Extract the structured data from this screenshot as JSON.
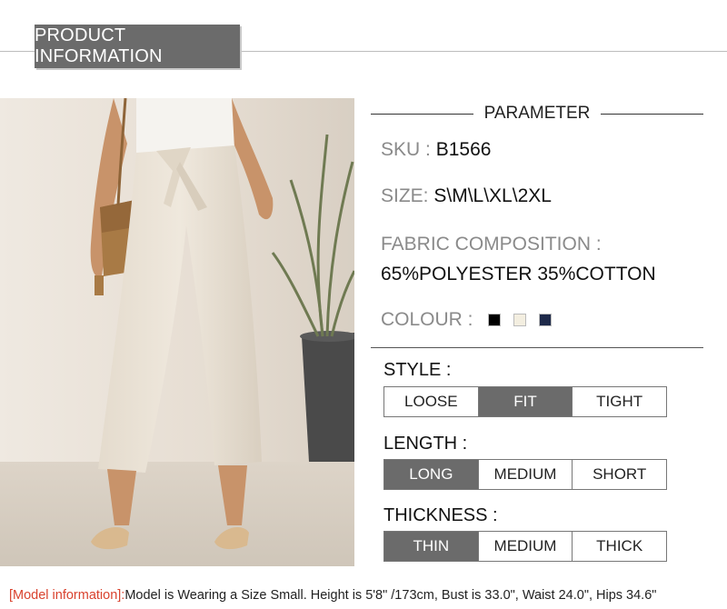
{
  "header": {
    "title": "PRODUCT  INFORMATION"
  },
  "parameter": {
    "heading": "PARAMETER",
    "sku": {
      "label": "SKU :",
      "value": "B1566"
    },
    "size": {
      "label": "SIZE:",
      "value": "S\\M\\L\\XL\\2XL"
    },
    "fabric": {
      "label": "FABRIC COMPOSITION :",
      "value": "65%POLYESTER 35%COTTON"
    },
    "colour": {
      "label": "COLOUR :",
      "swatches": [
        "#000000",
        "#f3eee0",
        "#1e2a4a"
      ]
    }
  },
  "style": {
    "title": "STYLE :",
    "options": [
      "LOOSE",
      "FIT",
      "TIGHT"
    ],
    "selected": "FIT"
  },
  "length": {
    "title": "LENGTH :",
    "options": [
      "LONG",
      "MEDIUM",
      "SHORT"
    ],
    "selected": "LONG"
  },
  "thickness": {
    "title": "THICKNESS :",
    "options": [
      "THIN",
      "MEDIUM",
      "THICK"
    ],
    "selected": "THIN"
  },
  "model_info": {
    "label": "[Model information]:",
    "text": "Model is Wearing a Size Small. Height is 5'8\" /173cm, Bust is 33.0\", Waist 24.0\", Hips 34.6\""
  },
  "colors": {
    "accent_gray": "#6b6b6b",
    "highlight_red": "#d9432f"
  }
}
